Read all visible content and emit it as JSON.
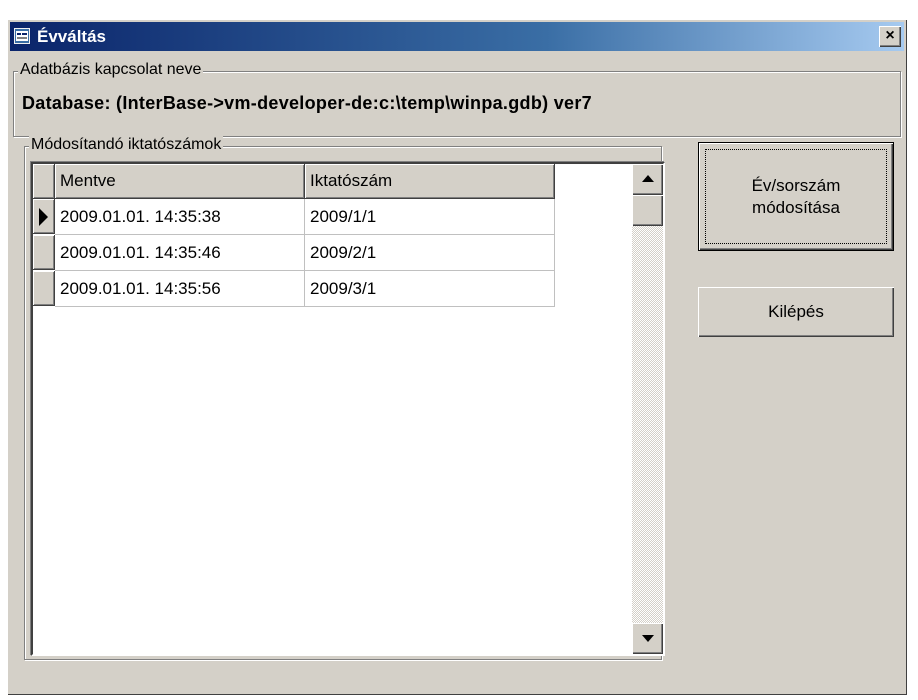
{
  "window": {
    "title": "Évváltás",
    "close_symbol": "×",
    "icon": "app-window-icon"
  },
  "connection_group": {
    "label": "Adatbázis kapcsolat neve",
    "database_text": "Database: (InterBase->vm-developer-de:c:\\temp\\winpa.gdb) ver7"
  },
  "records_group": {
    "label": "Módosítandó iktatószámok",
    "columns": [
      "Mentve",
      "Iktatószám"
    ],
    "rows": [
      {
        "saved": "2009.01.01. 14:35:38",
        "number": "2009/1/1"
      },
      {
        "saved": "2009.01.01. 14:35:46",
        "number": "2009/2/1"
      },
      {
        "saved": "2009.01.01. 14:35:56",
        "number": "2009/3/1"
      }
    ],
    "current_row_index": 0
  },
  "buttons": {
    "modify_line1": "Év/sorszám",
    "modify_line2": "módosítása",
    "exit": "Kilépés"
  },
  "colors": {
    "titlebar_start": "#0a246a",
    "titlebar_end": "#a6caf0",
    "face": "#d4d0c8"
  }
}
